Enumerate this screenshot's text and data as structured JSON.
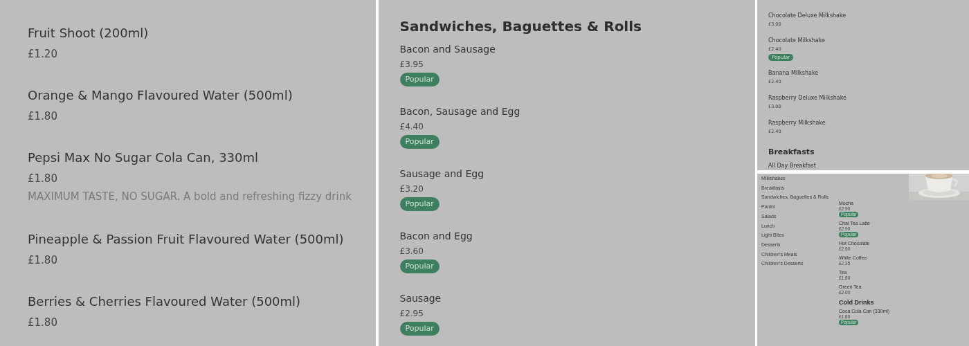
{
  "panels": [
    {
      "kind": "large",
      "sections": [
        {
          "items": [
            {
              "name": "Fruit Shoot (200ml)",
              "price": "£1.20",
              "popular": false
            },
            {
              "name": "Orange & Mango Flavoured Water (500ml)",
              "price": "£1.80",
              "popular": false
            },
            {
              "name": "Pepsi Max No Sugar Cola Can, 330ml",
              "price": "£1.80",
              "description": "MAXIMUM TASTE, NO SUGAR. A bold and refreshing fizzy drink",
              "popular": false
            },
            {
              "name": "Pineapple & Passion Fruit Flavoured Water (500ml)",
              "price": "£1.80",
              "popular": false
            },
            {
              "name": "Berries & Cherries Flavoured Water (500ml)",
              "price": "£1.80",
              "popular": false
            }
          ]
        }
      ]
    },
    {
      "kind": "medium",
      "sections": [
        {
          "heading": "Sandwiches, Baguettes & Rolls",
          "items": [
            {
              "name": "Bacon and Sausage",
              "price": "£3.95",
              "popular": true,
              "badge": "Popular"
            },
            {
              "name": "Bacon, Sausage and Egg",
              "price": "£4.40",
              "popular": true,
              "badge": "Popular"
            },
            {
              "name": "Sausage and Egg",
              "price": "£3.20",
              "popular": true,
              "badge": "Popular"
            },
            {
              "name": "Bacon and Egg",
              "price": "£3.60",
              "popular": true,
              "badge": "Popular"
            },
            {
              "name": "Sausage",
              "price": "£2.95",
              "popular": true,
              "badge": "Popular"
            }
          ]
        }
      ]
    },
    {
      "kind": "small",
      "sections": [
        {
          "items": [
            {
              "name": "Chocolate Deluxe Milkshake",
              "price": "£3.00",
              "popular": false
            },
            {
              "name": "Chocolate Milkshake",
              "price": "£2.40",
              "popular": true,
              "badge": "Popular"
            },
            {
              "name": "Banana Milkshake",
              "price": "£2.40",
              "popular": false
            },
            {
              "name": "Raspberry Deluxe Milkshake",
              "price": "£3.00",
              "popular": false
            },
            {
              "name": "Raspberry Milkshake",
              "price": "£2.40",
              "popular": false
            }
          ]
        },
        {
          "heading": "Breakfasts",
          "items": [
            {
              "name": "All Day Breakfast",
              "popular": false
            }
          ]
        }
      ]
    },
    {
      "kind": "tiny",
      "sidebar": [
        "Milkshakes",
        "Breakfasts",
        "Sandwiches, Baguettes & Rolls",
        "Panini",
        "Salads",
        "Lunch",
        "Light Bites",
        "Desserts",
        "Children's Meals",
        "Children's Desserts"
      ],
      "sections": [
        {
          "items": [
            {
              "name": "Mocha",
              "price": "£2.90",
              "popular": true,
              "badge": "Popular"
            },
            {
              "name": "Chai Tea Latte",
              "price": "£2.90",
              "popular": true,
              "badge": "Popular"
            },
            {
              "name": "Hot Chocolate",
              "price": "£2.60",
              "popular": false
            },
            {
              "name": "White Coffee",
              "price": "£2.35",
              "popular": false
            },
            {
              "name": "Tea",
              "price": "£1.80",
              "popular": false
            },
            {
              "name": "Green Tea",
              "price": "£2.00",
              "popular": false
            }
          ]
        },
        {
          "heading": "Cold Drinks",
          "items": [
            {
              "name": "Coca Cola Can (330ml)",
              "price": "£1.80",
              "popular": true,
              "badge": "Popular"
            }
          ]
        }
      ]
    }
  ]
}
